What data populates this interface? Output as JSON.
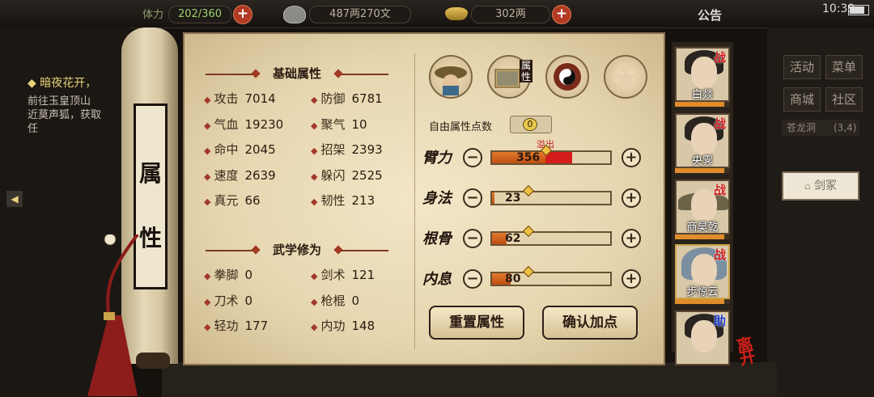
{
  "top_bar": {
    "stamina_label": "体力",
    "stamina_value": "202/360",
    "silver_value": "487两270文",
    "gold_value": "302两",
    "notice": "公告",
    "time": "10:39"
  },
  "quest": {
    "title": "暗夜花开，",
    "lines": [
      "前往玉皇顶山",
      "近莫声狐，获取",
      "任"
    ]
  },
  "scroll": {
    "title": "属性"
  },
  "basic": {
    "header": "基础属性",
    "stats": [
      {
        "label": "攻击",
        "value": "7014"
      },
      {
        "label": "防御",
        "value": "6781"
      },
      {
        "label": "气血",
        "value": "19230"
      },
      {
        "label": "聚气",
        "value": "10"
      },
      {
        "label": "命中",
        "value": "2045"
      },
      {
        "label": "招架",
        "value": "2393"
      },
      {
        "label": "速度",
        "value": "2639"
      },
      {
        "label": "躲闪",
        "value": "2525"
      },
      {
        "label": "真元",
        "value": "66"
      },
      {
        "label": "韧性",
        "value": "213"
      }
    ]
  },
  "martial": {
    "header": "武学修为",
    "stats": [
      {
        "label": "拳脚",
        "value": "0"
      },
      {
        "label": "剑术",
        "value": "121"
      },
      {
        "label": "刀术",
        "value": "0"
      },
      {
        "label": "枪棍",
        "value": "0"
      },
      {
        "label": "轻功",
        "value": "177"
      },
      {
        "label": "内功",
        "value": "148"
      }
    ]
  },
  "tabs": {
    "icons": [
      "character-hat-icon",
      "attribute-scroll-icon",
      "yinyang-bagua-icon",
      "meridian-body-icon"
    ],
    "attribute_tab_label": "属性"
  },
  "free_points": {
    "label": "自由属性点数",
    "value": "0"
  },
  "overflow_label": "溢出",
  "attributes": [
    {
      "name": "臂力",
      "value": "356",
      "fill": 0.45,
      "overflow": 0.23
    },
    {
      "name": "身法",
      "value": "23",
      "fill": 0.02,
      "overflow": 0
    },
    {
      "name": "根骨",
      "value": "62",
      "fill": 0.12,
      "overflow": 0
    },
    {
      "name": "内息",
      "value": "80",
      "fill": 0.16,
      "overflow": 0
    }
  ],
  "buttons": {
    "minus": "−",
    "plus": "+",
    "reset": "重置属性",
    "confirm": "确认加点"
  },
  "party": [
    {
      "name": "白燚",
      "tag": "战"
    },
    {
      "name": "央霁",
      "tag": "战"
    },
    {
      "name": "商昊乾",
      "tag": "战"
    },
    {
      "name": "步惊云",
      "tag": "战"
    },
    {
      "name": "",
      "tag": "助"
    }
  ],
  "leave_label": "离开",
  "right_menu": {
    "buttons": [
      "活动",
      "菜单",
      "商城",
      "社区"
    ],
    "location": "苍龙洞",
    "coords": "(3,4)",
    "npc": "剑冢"
  },
  "colors": {
    "parchment": "#e6d6b0",
    "accent_red": "#d61d1d",
    "bar_orange": "#e17a2c"
  }
}
